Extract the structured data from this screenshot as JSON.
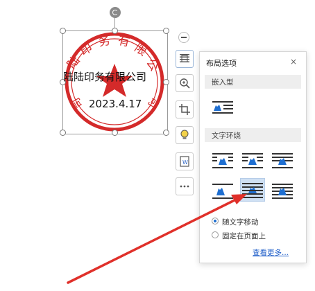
{
  "stamp": {
    "company": "陆陆印务有限公司",
    "date": "2023.4.17",
    "ring_text": "陆陆印务有限公司",
    "ring_color": "#d42a2a"
  },
  "toolbar": {
    "items": [
      {
        "icon": "minus-icon"
      },
      {
        "icon": "layout-options-icon"
      },
      {
        "icon": "zoom-icon"
      },
      {
        "icon": "crop-icon"
      },
      {
        "icon": "lightbulb-icon"
      },
      {
        "icon": "convert-icon"
      },
      {
        "icon": "more-icon"
      }
    ]
  },
  "panel": {
    "title": "布局选项",
    "close": "×",
    "inline_section": "嵌入型",
    "wrap_section": "文字环绕",
    "radio_move_with_text": "随文字移动",
    "radio_fix_position": "固定在页面上",
    "radio_selected": "随文字移动",
    "see_more": "查看更多...",
    "selected_option_index": 3
  },
  "colors": {
    "accent": "#1f6fd1",
    "arrow": "#e0302a",
    "selected_option_bg": "#cfe0f3"
  }
}
